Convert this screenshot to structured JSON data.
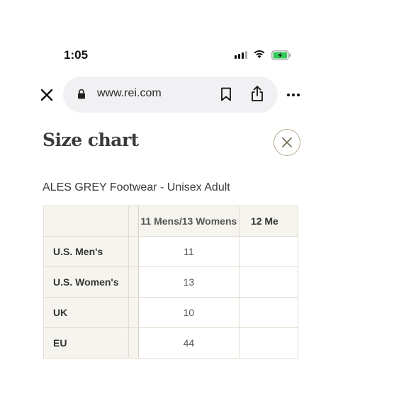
{
  "status_bar": {
    "time": "1:05"
  },
  "browser": {
    "url": "www.rei.com"
  },
  "modal": {
    "title": "Size chart",
    "product": "ALES GREY Footwear - Unisex Adult"
  },
  "table": {
    "columns": [
      "11 Mens/13 Womens",
      "12 Me"
    ],
    "rows": [
      {
        "label": "U.S. Men's",
        "values": [
          "11",
          ""
        ]
      },
      {
        "label": "U.S. Women's",
        "values": [
          "13",
          ""
        ]
      },
      {
        "label": "UK",
        "values": [
          "10",
          ""
        ]
      },
      {
        "label": "EU",
        "values": [
          "44",
          ""
        ]
      }
    ]
  },
  "colors": {
    "accent_border": "#b7a98e",
    "table_header_bg": "#f6f4ef",
    "battery_green": "#34c759"
  }
}
